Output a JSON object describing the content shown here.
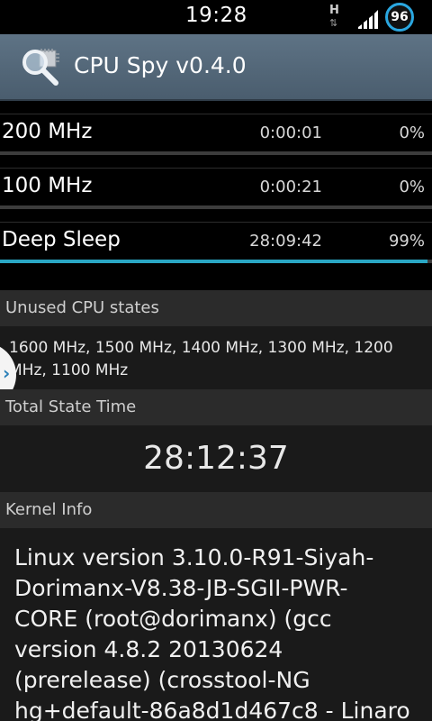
{
  "status_bar": {
    "time": "19:28",
    "network_type": "H",
    "network_arrows": "⇅",
    "battery_level": "96",
    "battery_color": "#2aa7e0"
  },
  "action_bar": {
    "title": "CPU Spy v0.4.0",
    "icon": "magnifier-chip-icon"
  },
  "states": [
    {
      "freq": "200 MHz",
      "duration": "0:00:01",
      "percent": "0%",
      "fill": 0.0
    },
    {
      "freq": "100 MHz",
      "duration": "0:00:21",
      "percent": "0%",
      "fill": 0.0
    },
    {
      "freq": "Deep Sleep",
      "duration": "28:09:42",
      "percent": "99%",
      "fill": 0.99
    }
  ],
  "unused": {
    "header": "Unused CPU states",
    "text": "1600 MHz, 1500 MHz, 1400 MHz, 1300 MHz, 1200 MHz, 1100 MHz"
  },
  "total": {
    "header": "Total State Time",
    "value": "28:12:37"
  },
  "kernel": {
    "header": "Kernel Info",
    "text": "Linux version 3.10.0-R91-Siyah-Dorimanx-V8.38-JB-SGII-PWR-CORE (root@dorimanx) (gcc version 4.8.2 20130624 (prerelease) (crosstool-NG hg+default-86a8d1d467c8 - Linaro"
  },
  "accent_color": "#2aa7c4",
  "drawer_handle_icon": "chevron-right-icon"
}
